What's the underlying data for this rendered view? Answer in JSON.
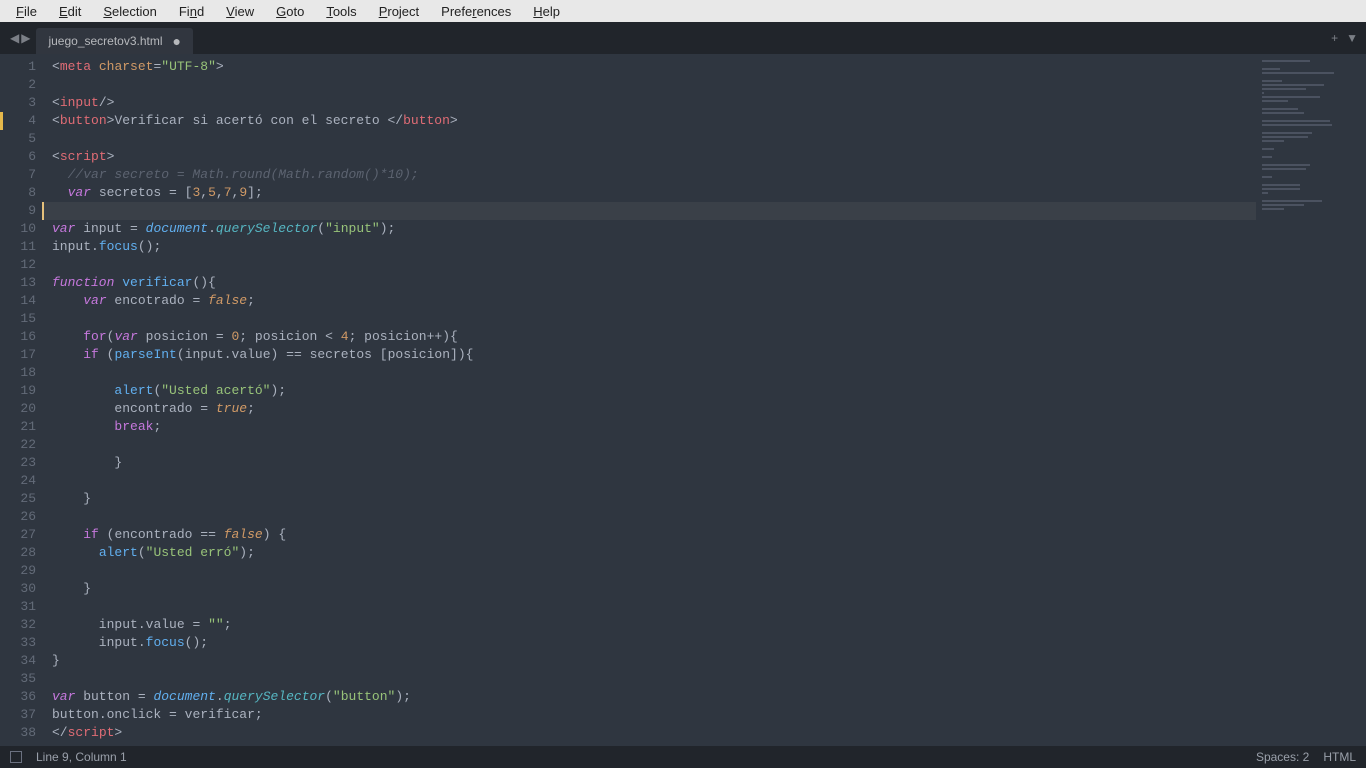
{
  "menu": [
    "File",
    "Edit",
    "Selection",
    "Find",
    "View",
    "Goto",
    "Tools",
    "Project",
    "Preferences",
    "Help"
  ],
  "menu_underline": [
    0,
    0,
    0,
    2,
    0,
    0,
    0,
    0,
    5,
    0
  ],
  "tab": {
    "name": "juego_secretov3.html",
    "dirty": "●"
  },
  "tabright": {
    "plus": "+",
    "arrow": "▼"
  },
  "nav": {
    "back": "◀",
    "fwd": "▶"
  },
  "status": {
    "pos": "Line 9, Column 1",
    "spaces": "Spaces: 2",
    "lang": "HTML"
  },
  "lines": [
    {
      "n": 1,
      "seg": [
        [
          "pun",
          "<"
        ],
        [
          "tag",
          "meta"
        ],
        [
          "txt",
          " "
        ],
        [
          "attr",
          "charset"
        ],
        [
          "pun",
          "="
        ],
        [
          "str",
          "\"UTF-8\""
        ],
        [
          "pun",
          ">"
        ]
      ]
    },
    {
      "n": 2,
      "seg": []
    },
    {
      "n": 3,
      "seg": [
        [
          "pun",
          "<"
        ],
        [
          "tag",
          "input"
        ],
        [
          "pun",
          "/>"
        ]
      ]
    },
    {
      "n": 4,
      "seg": [
        [
          "pun",
          "<"
        ],
        [
          "tag",
          "button"
        ],
        [
          "pun",
          ">"
        ],
        [
          "txt",
          "Verificar si acertó con el secreto "
        ],
        [
          "pun",
          "</"
        ],
        [
          "tag",
          "button"
        ],
        [
          "pun",
          ">"
        ]
      ],
      "mod": true
    },
    {
      "n": 5,
      "seg": []
    },
    {
      "n": 6,
      "seg": [
        [
          "pun",
          "<"
        ],
        [
          "tag",
          "script"
        ],
        [
          "pun",
          ">"
        ]
      ]
    },
    {
      "n": 7,
      "seg": [
        [
          "txt",
          "  "
        ],
        [
          "com",
          "//var secreto = Math.round(Math.random()*10);"
        ]
      ]
    },
    {
      "n": 8,
      "seg": [
        [
          "txt",
          "  "
        ],
        [
          "kw",
          "var"
        ],
        [
          "txt",
          " secretos "
        ],
        [
          "pun",
          "="
        ],
        [
          "txt",
          " ["
        ],
        [
          "num",
          "3"
        ],
        [
          "pun",
          ","
        ],
        [
          "num",
          "5"
        ],
        [
          "pun",
          ","
        ],
        [
          "num",
          "7"
        ],
        [
          "pun",
          ","
        ],
        [
          "num",
          "9"
        ],
        [
          "txt",
          "];"
        ]
      ]
    },
    {
      "n": 9,
      "seg": [],
      "current": true,
      "mod": true
    },
    {
      "n": 10,
      "seg": [
        [
          "kw",
          "var"
        ],
        [
          "txt",
          " input "
        ],
        [
          "pun",
          "="
        ],
        [
          "txt",
          " "
        ],
        [
          "obj",
          "document"
        ],
        [
          "pun",
          "."
        ],
        [
          "prop",
          "querySelector"
        ],
        [
          "pun",
          "("
        ],
        [
          "str",
          "\"input\""
        ],
        [
          "pun",
          ");"
        ]
      ]
    },
    {
      "n": 11,
      "seg": [
        [
          "txt",
          "input"
        ],
        [
          "pun",
          "."
        ],
        [
          "fn",
          "focus"
        ],
        [
          "pun",
          "();"
        ]
      ]
    },
    {
      "n": 12,
      "seg": []
    },
    {
      "n": 13,
      "seg": [
        [
          "kw",
          "function"
        ],
        [
          "txt",
          " "
        ],
        [
          "fname",
          "verificar"
        ],
        [
          "pun",
          "(){"
        ]
      ]
    },
    {
      "n": 14,
      "seg": [
        [
          "txt",
          "    "
        ],
        [
          "kw",
          "var"
        ],
        [
          "txt",
          " encotrado "
        ],
        [
          "pun",
          "="
        ],
        [
          "txt",
          " "
        ],
        [
          "bool",
          "false"
        ],
        [
          "pun",
          ";"
        ]
      ]
    },
    {
      "n": 15,
      "seg": []
    },
    {
      "n": 16,
      "seg": [
        [
          "txt",
          "    "
        ],
        [
          "kw2",
          "for"
        ],
        [
          "pun",
          "("
        ],
        [
          "kw",
          "var"
        ],
        [
          "txt",
          " posicion "
        ],
        [
          "pun",
          "="
        ],
        [
          "txt",
          " "
        ],
        [
          "num",
          "0"
        ],
        [
          "pun",
          ";"
        ],
        [
          "txt",
          " posicion "
        ],
        [
          "pun",
          "<"
        ],
        [
          "txt",
          " "
        ],
        [
          "num",
          "4"
        ],
        [
          "pun",
          ";"
        ],
        [
          "txt",
          " posicion"
        ],
        [
          "pun",
          "++"
        ],
        [
          "pun",
          "){"
        ]
      ]
    },
    {
      "n": 17,
      "seg": [
        [
          "txt",
          "    "
        ],
        [
          "kw2",
          "if"
        ],
        [
          "txt",
          " "
        ],
        [
          "pun",
          "("
        ],
        [
          "fn",
          "parseInt"
        ],
        [
          "pun",
          "("
        ],
        [
          "txt",
          "input"
        ],
        [
          "pun",
          "."
        ],
        [
          "txt",
          "value"
        ],
        [
          "pun",
          ")"
        ],
        [
          "txt",
          " "
        ],
        [
          "pun",
          "=="
        ],
        [
          "txt",
          " secretos "
        ],
        [
          "pun",
          "["
        ],
        [
          "txt",
          "posicion"
        ],
        [
          "pun",
          "]){"
        ]
      ]
    },
    {
      "n": 18,
      "seg": []
    },
    {
      "n": 19,
      "seg": [
        [
          "txt",
          "        "
        ],
        [
          "fn",
          "alert"
        ],
        [
          "pun",
          "("
        ],
        [
          "str",
          "\"Usted acertó\""
        ],
        [
          "pun",
          ");"
        ]
      ]
    },
    {
      "n": 20,
      "seg": [
        [
          "txt",
          "        encontrado "
        ],
        [
          "pun",
          "="
        ],
        [
          "txt",
          " "
        ],
        [
          "bool",
          "true"
        ],
        [
          "pun",
          ";"
        ]
      ]
    },
    {
      "n": 21,
      "seg": [
        [
          "txt",
          "        "
        ],
        [
          "kw2",
          "break"
        ],
        [
          "pun",
          ";"
        ]
      ]
    },
    {
      "n": 22,
      "seg": []
    },
    {
      "n": 23,
      "seg": [
        [
          "txt",
          "        "
        ],
        [
          "pun",
          "}"
        ]
      ]
    },
    {
      "n": 24,
      "seg": []
    },
    {
      "n": 25,
      "seg": [
        [
          "txt",
          "    "
        ],
        [
          "pun",
          "}"
        ]
      ]
    },
    {
      "n": 26,
      "seg": []
    },
    {
      "n": 27,
      "seg": [
        [
          "txt",
          "    "
        ],
        [
          "kw2",
          "if"
        ],
        [
          "txt",
          " "
        ],
        [
          "pun",
          "("
        ],
        [
          "txt",
          "encontrado "
        ],
        [
          "pun",
          "=="
        ],
        [
          "txt",
          " "
        ],
        [
          "bool",
          "false"
        ],
        [
          "pun",
          ")"
        ],
        [
          "txt",
          " "
        ],
        [
          "pun",
          "{"
        ]
      ]
    },
    {
      "n": 28,
      "seg": [
        [
          "txt",
          "      "
        ],
        [
          "fn",
          "alert"
        ],
        [
          "pun",
          "("
        ],
        [
          "str",
          "\"Usted erró\""
        ],
        [
          "pun",
          ");"
        ]
      ]
    },
    {
      "n": 29,
      "seg": []
    },
    {
      "n": 30,
      "seg": [
        [
          "txt",
          "    "
        ],
        [
          "pun",
          "}"
        ]
      ]
    },
    {
      "n": 31,
      "seg": []
    },
    {
      "n": 32,
      "seg": [
        [
          "txt",
          "      input"
        ],
        [
          "pun",
          "."
        ],
        [
          "txt",
          "value "
        ],
        [
          "pun",
          "="
        ],
        [
          "txt",
          " "
        ],
        [
          "str",
          "\"\""
        ],
        [
          "pun",
          ";"
        ]
      ]
    },
    {
      "n": 33,
      "seg": [
        [
          "txt",
          "      input"
        ],
        [
          "pun",
          "."
        ],
        [
          "fn",
          "focus"
        ],
        [
          "pun",
          "();"
        ]
      ]
    },
    {
      "n": 34,
      "seg": [
        [
          "pun",
          "}"
        ]
      ]
    },
    {
      "n": 35,
      "seg": []
    },
    {
      "n": 36,
      "seg": [
        [
          "kw",
          "var"
        ],
        [
          "txt",
          " button "
        ],
        [
          "pun",
          "="
        ],
        [
          "txt",
          " "
        ],
        [
          "obj",
          "document"
        ],
        [
          "pun",
          "."
        ],
        [
          "prop",
          "querySelector"
        ],
        [
          "pun",
          "("
        ],
        [
          "str",
          "\"button\""
        ],
        [
          "pun",
          ");"
        ]
      ]
    },
    {
      "n": 37,
      "seg": [
        [
          "txt",
          "button"
        ],
        [
          "pun",
          "."
        ],
        [
          "txt",
          "onclick "
        ],
        [
          "pun",
          "="
        ],
        [
          "txt",
          " verificar"
        ],
        [
          "pun",
          ";"
        ]
      ]
    },
    {
      "n": 38,
      "seg": [
        [
          "pun",
          "</"
        ],
        [
          "tag",
          "script"
        ],
        [
          "pun",
          ">"
        ]
      ]
    }
  ],
  "minimap_widths": [
    48,
    0,
    18,
    72,
    0,
    20,
    62,
    44,
    2,
    58,
    26,
    0,
    36,
    42,
    0,
    68,
    70,
    0,
    50,
    46,
    22,
    0,
    12,
    0,
    10,
    0,
    48,
    44,
    0,
    10,
    0,
    38,
    38,
    6,
    0,
    60,
    42,
    22
  ]
}
